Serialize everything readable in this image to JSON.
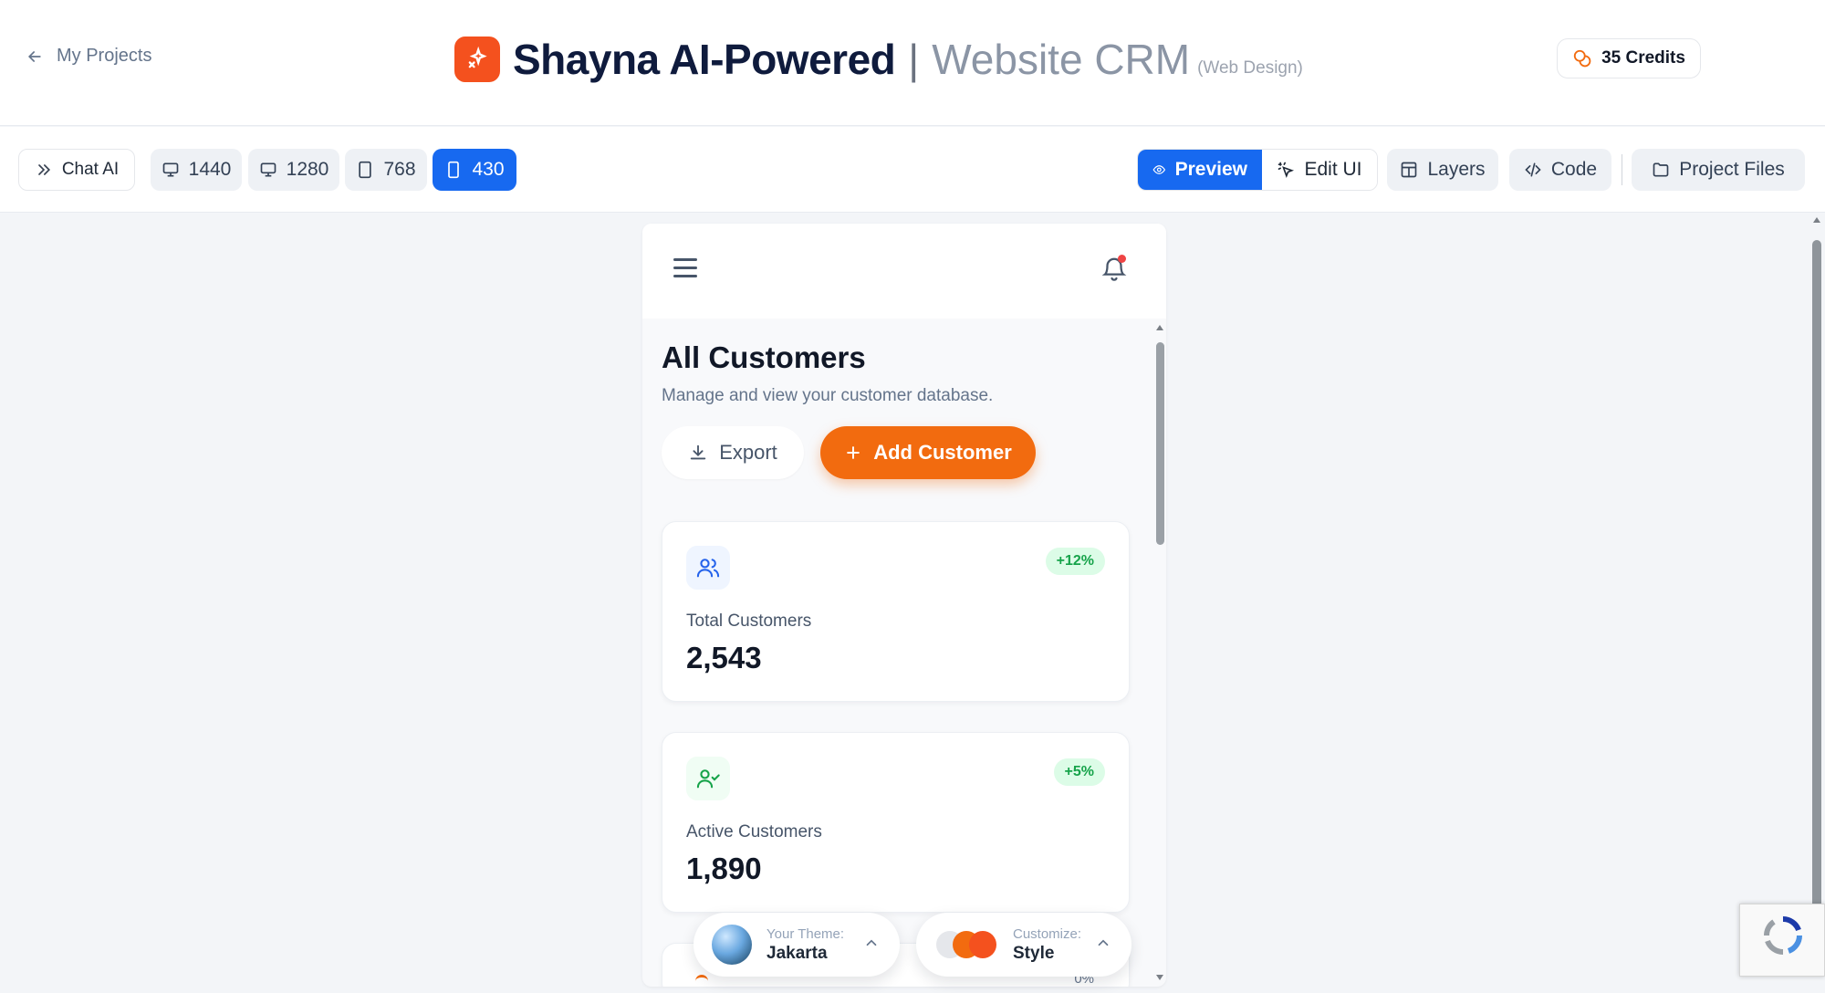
{
  "header": {
    "back_label": "My Projects",
    "title_main": "Shayna AI-Powered",
    "title_separator": "|",
    "title_sub": "Website CRM",
    "title_note": "(Web Design)",
    "credits": "35 Credits"
  },
  "toolbar": {
    "chat_ai": "Chat AI",
    "viewports": [
      "1440",
      "1280",
      "768",
      "430"
    ],
    "active_viewport": "430",
    "preview": "Preview",
    "edit_ui": "Edit UI",
    "layers": "Layers",
    "code": "Code",
    "project_files": "Project Files"
  },
  "device": {
    "page_title": "All Customers",
    "page_subtitle": "Manage and view your customer database.",
    "export_label": "Export",
    "add_customer_label": "Add Customer",
    "stats": [
      {
        "label": "Total Customers",
        "value": "2,543",
        "change": "+12%"
      },
      {
        "label": "Active Customers",
        "value": "1,890",
        "change": "+5%"
      }
    ],
    "peek_change": "0%"
  },
  "footer": {
    "theme_caption": "Your Theme:",
    "theme_value": "Jakarta",
    "customize_caption": "Customize:",
    "customize_value": "Style"
  },
  "colors": {
    "brand_orange": "#f26b0f",
    "logo_red": "#f4511e",
    "active_blue": "#1769f0",
    "badge_green": "#16a34a"
  }
}
